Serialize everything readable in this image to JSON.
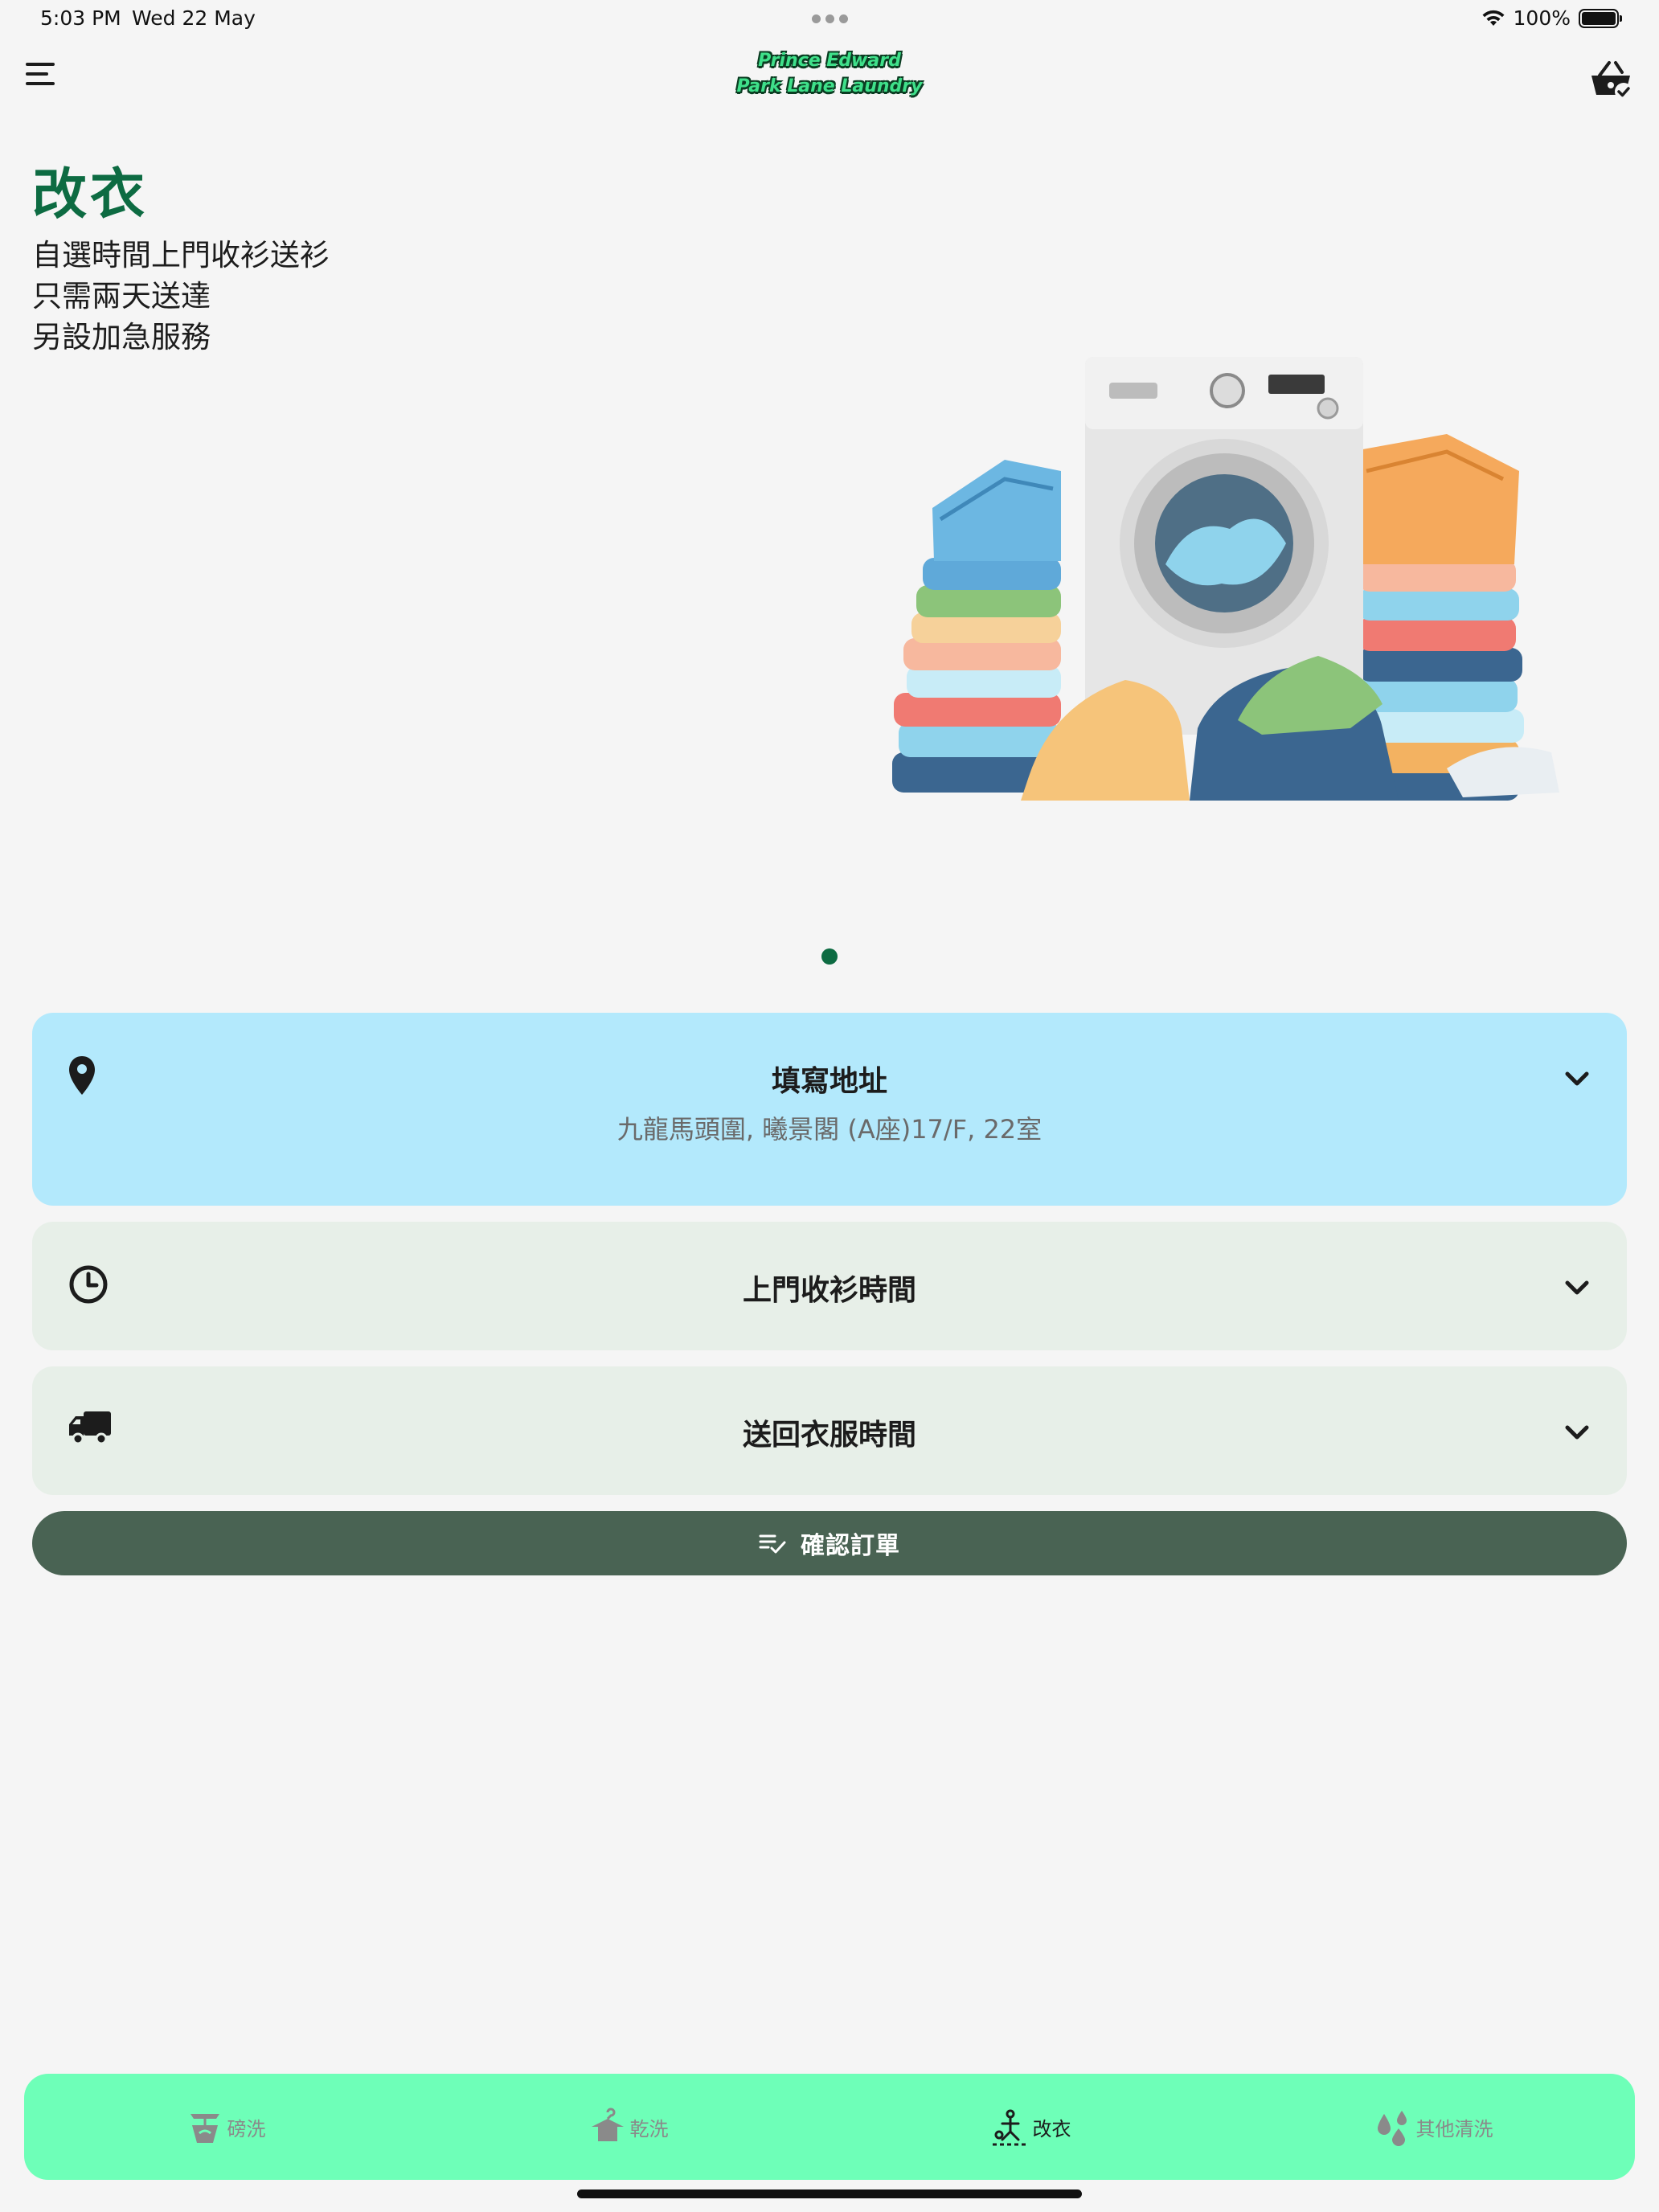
{
  "status_bar": {
    "time": "5:03 PM",
    "date": "Wed 22 May",
    "battery": "100%",
    "battery_level": 1.0,
    "icons": [
      "wifi-icon",
      "battery-icon"
    ]
  },
  "app_bar": {
    "logo_line1": "Prince Edward",
    "logo_line2": "Park Lane Laundry",
    "icons": [
      "menu-icon",
      "basket-check-icon"
    ]
  },
  "hero": {
    "title": "改衣",
    "lines": [
      "自選時間上門收衫送衫",
      "只需兩天送達",
      "另設加急服務"
    ],
    "carousel_page": 1,
    "carousel_count": 1,
    "title_color": "#0d6b42"
  },
  "cards": {
    "address": {
      "title": "填寫地址",
      "value": "九龍馬頭圍, 曦景閣 (A座)17/F, 22室",
      "icon": "location-pin-icon",
      "bg": "#b3e9fc"
    },
    "pickup": {
      "title": "上門收衫時間",
      "icon": "clock-icon",
      "bg": "#e7efe8"
    },
    "delivery": {
      "title": "送回衣服時間",
      "icon": "truck-icon",
      "bg": "#e7efe8"
    }
  },
  "confirm": {
    "label": "確認訂單",
    "icon": "list-check-icon",
    "bg": "#496353"
  },
  "bottom_nav": {
    "bg": "#6effb8",
    "items": [
      {
        "label": "磅洗",
        "icon": "washer-icon",
        "active": false
      },
      {
        "label": "乾洗",
        "icon": "hanger-shirt-icon",
        "active": false
      },
      {
        "label": "改衣",
        "icon": "sewing-icon",
        "active": true
      },
      {
        "label": "其他清洗",
        "icon": "droplets-icon",
        "active": false
      }
    ]
  }
}
